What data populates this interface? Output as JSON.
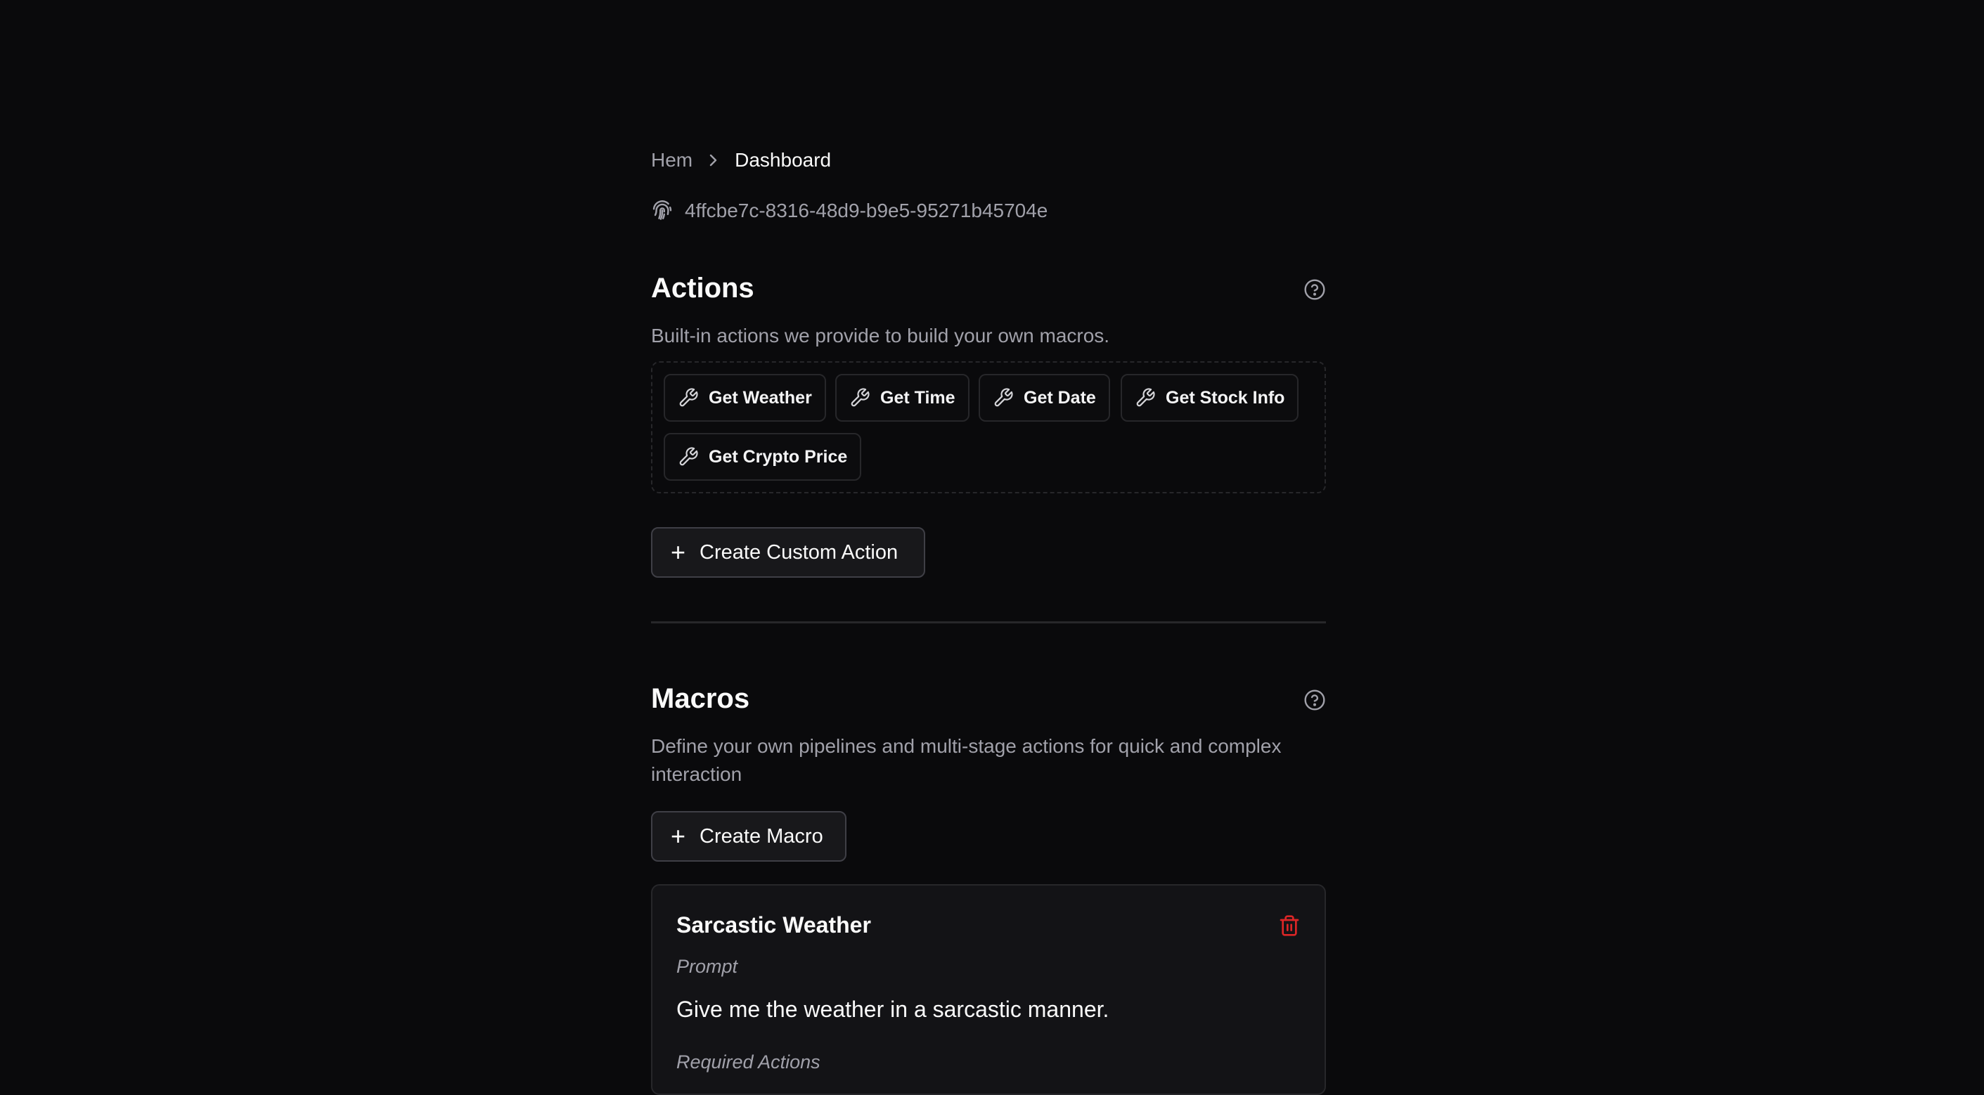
{
  "breadcrumb": {
    "home": "Hem",
    "current": "Dashboard"
  },
  "user": {
    "id": "4ffcbe7c-8316-48d9-b9e5-95271b45704e"
  },
  "actions": {
    "title": "Actions",
    "description": "Built-in actions we provide to build your own macros.",
    "items": [
      "Get Weather",
      "Get Time",
      "Get Date",
      "Get Stock Info",
      "Get Crypto Price"
    ],
    "create_label": "Create Custom Action"
  },
  "macros": {
    "title": "Macros",
    "description": "Define your own pipelines and multi-stage actions for quick and complex interaction",
    "create_label": "Create Macro",
    "list": [
      {
        "name": "Sarcastic Weather",
        "prompt_label": "Prompt",
        "prompt": "Give me the weather in a sarcastic manner.",
        "required_label": "Required Actions"
      }
    ]
  },
  "colors": {
    "background": "#0a0a0c",
    "danger": "#dc2626",
    "muted": "#a1a1aa"
  }
}
